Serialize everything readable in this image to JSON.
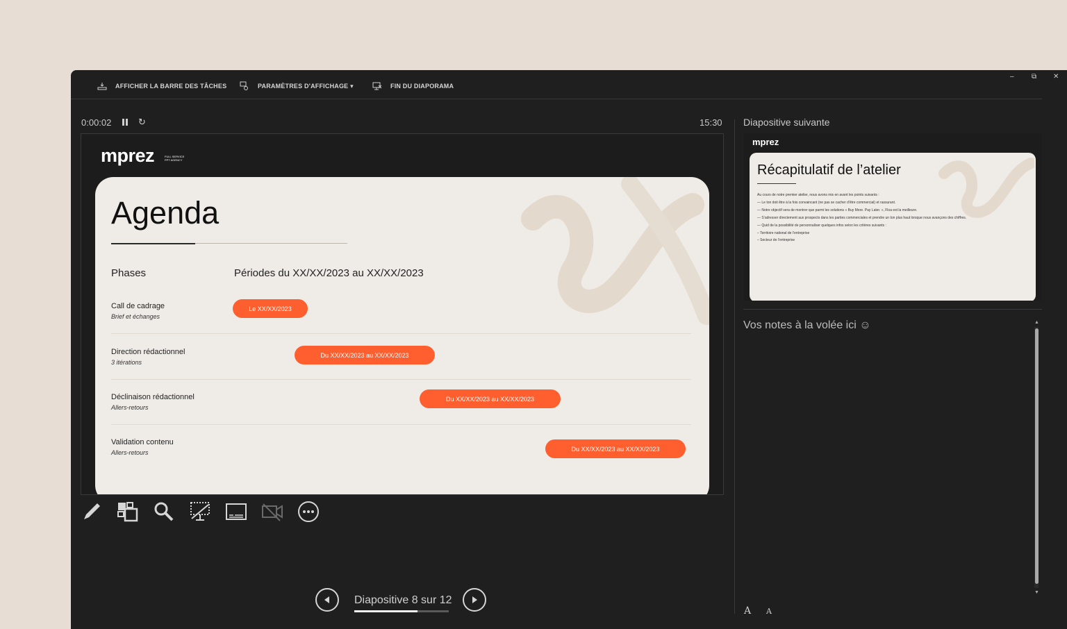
{
  "toolbar": {
    "taskbar": "AFFICHER LA BARRE DES TÂCHES",
    "display_settings": "PARAMÈTRES D'AFFICHAGE ▾",
    "end_show": "FIN DU DIAPORAMA"
  },
  "window_controls": {
    "minimize": "–",
    "restore": "⧉",
    "close": "✕"
  },
  "presenter": {
    "elapsed": "0:00:02",
    "reset_glyph": "↻",
    "clock": "15:30"
  },
  "slide": {
    "logo": "mprez",
    "logo_small": "FULL SERVICE PPT AGENCY",
    "title": "Agenda",
    "col_phases": "Phases",
    "col_periods": "Périodes du XX/XX/2023 au XX/XX/2023",
    "rows": [
      {
        "title": "Call de cadrage",
        "sub": "Brief et échanges",
        "pill": "Le XX/XX/2023"
      },
      {
        "title": "Direction rédactionnel",
        "sub": "3 itérations",
        "pill": "Du XX/XX/2023 au XX/XX/2023"
      },
      {
        "title": "Déclinaison rédactionnel",
        "sub": "Allers-retours",
        "pill": "Du XX/XX/2023 au XX/XX/2023"
      },
      {
        "title": "Validation contenu",
        "sub": "Allers-retours",
        "pill": "Du XX/XX/2023 au XX/XX/2023"
      }
    ],
    "accent": "#ff5f2e"
  },
  "navigation": {
    "counter": "Diapositive 8 sur 12",
    "progress": 0.667
  },
  "next_slide": {
    "label": "Diapositive suivante",
    "logo": "mprez",
    "title": "Récapitulatif de l’atelier",
    "lines": [
      "Au cours de notre premier atelier, nous avons mis en avant les points suivants :",
      "—  Le ton doit être à la fois convaincant (ne pas se cacher d’être commercial) et rassurant.",
      "—  Notre objectif sera de montrer que parmi les solutions « Buy More. Pay Later. », Floa est la meilleure.",
      "—  S’adresser directement aux prospects dans les parties commerciales et prendre un ton plus haut lorsque nous avançons des chiffres.",
      "—  Quid de la possibilité de personnaliser quelques infos selon les critères suivants :",
      "     –  Territoire national de l’entreprise",
      "     –  Secteur de l’entreprise"
    ]
  },
  "notes": {
    "text": "Vos notes à la volée ici ☺"
  },
  "font_controls": {
    "increase": "A",
    "decrease": "A"
  }
}
